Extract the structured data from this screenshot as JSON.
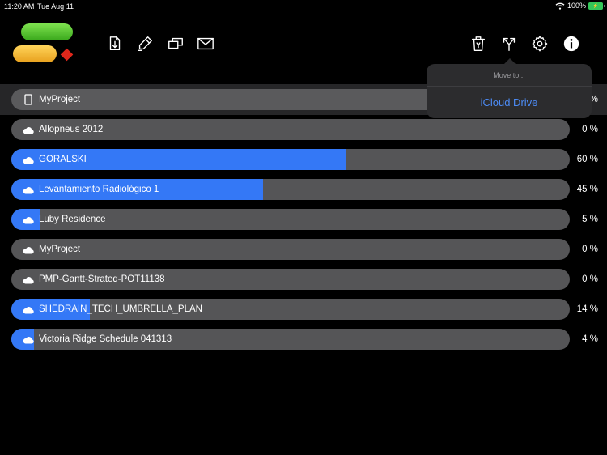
{
  "status_bar": {
    "time": "11:20 AM",
    "date": "Tue Aug 11",
    "battery": "100%"
  },
  "toolbar": {
    "tools_left": [
      {
        "name": "import-icon"
      },
      {
        "name": "pen-icon"
      },
      {
        "name": "windows-icon"
      },
      {
        "name": "mail-icon"
      }
    ],
    "tools_right": [
      {
        "name": "trash-icon"
      },
      {
        "name": "split-arrow-icon"
      },
      {
        "name": "gear-icon"
      },
      {
        "name": "info-icon"
      }
    ]
  },
  "move_popover": {
    "title": "Move to...",
    "option": "iCloud Drive"
  },
  "accent_color": "#3478f6",
  "projects": [
    {
      "name": "MyProject",
      "icon": "document-icon",
      "percent_label": "%",
      "progress": 0,
      "selected": true
    },
    {
      "name": "Allopneus 2012",
      "icon": "cloud-icon",
      "percent_label": "0 %",
      "progress": 0
    },
    {
      "name": "GORALSKI",
      "icon": "cloud-icon",
      "percent_label": "60 %",
      "progress": 60
    },
    {
      "name": "Levantamiento Radiológico 1",
      "icon": "cloud-icon",
      "percent_label": "45 %",
      "progress": 45
    },
    {
      "name": "Luby Residence",
      "icon": "cloud-icon",
      "percent_label": "5 %",
      "progress": 5
    },
    {
      "name": "MyProject",
      "icon": "cloud-icon",
      "percent_label": "0 %",
      "progress": 0
    },
    {
      "name": "PMP-Gantt-Strateq-POT11138",
      "icon": "cloud-icon",
      "percent_label": "0 %",
      "progress": 0
    },
    {
      "name": "SHEDRAIN_TECH_UMBRELLA_PLAN",
      "icon": "cloud-icon",
      "percent_label": "14 %",
      "progress": 14
    },
    {
      "name": "Victoria Ridge Schedule 041313",
      "icon": "cloud-icon",
      "percent_label": "4 %",
      "progress": 4
    }
  ]
}
